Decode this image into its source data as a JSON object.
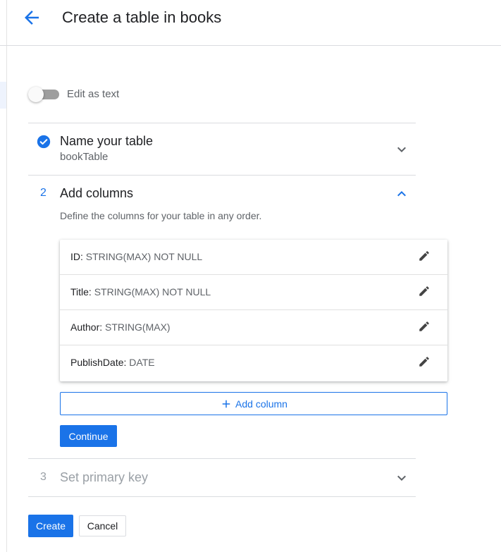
{
  "header": {
    "title": "Create a table in books",
    "back_icon": "arrow-back-icon"
  },
  "edit_as_text": {
    "label": "Edit as text",
    "enabled": false
  },
  "steps": [
    {
      "number": "1",
      "title": "Name your table",
      "summary": "bookTable",
      "status": "completed",
      "expanded": false,
      "icon": "check-circle-icon"
    },
    {
      "number": "2",
      "title": "Add columns",
      "description": "Define the columns for your table in any order.",
      "status": "active",
      "expanded": true,
      "columns": [
        {
          "name": "ID:",
          "type": "STRING(MAX) NOT NULL"
        },
        {
          "name": "Title:",
          "type": "STRING(MAX) NOT NULL"
        },
        {
          "name": "Author:",
          "type": "STRING(MAX)"
        },
        {
          "name": "PublishDate:",
          "type": "DATE"
        }
      ],
      "add_column_label": "Add column",
      "continue_label": "Continue"
    },
    {
      "number": "3",
      "title": "Set primary key",
      "status": "disabled",
      "expanded": false
    }
  ],
  "actions": {
    "create_label": "Create",
    "cancel_label": "Cancel"
  },
  "colors": {
    "accent": "#1a73e8",
    "text": "#202124",
    "secondary": "#5f6368",
    "disabled": "#9aa0a6",
    "divider": "#dadce0"
  }
}
